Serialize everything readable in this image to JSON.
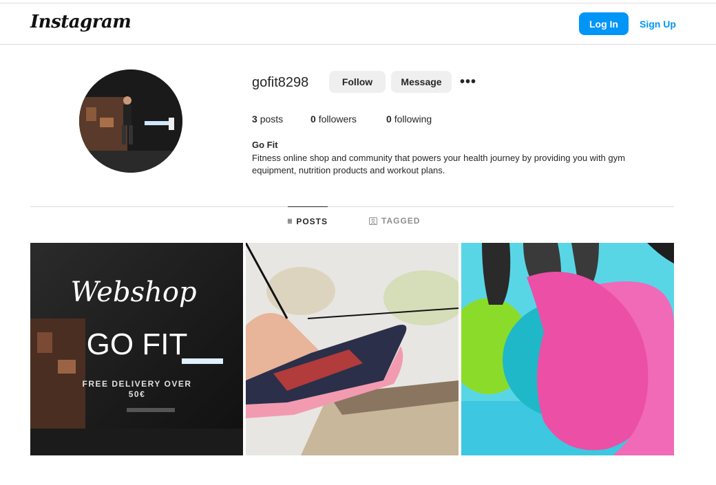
{
  "header": {
    "logo": "Instagram",
    "login_label": "Log In",
    "signup_label": "Sign Up"
  },
  "profile": {
    "username": "gofit8298",
    "follow_label": "Follow",
    "message_label": "Message",
    "more_label": "•••",
    "posts_count": "3",
    "posts_label": "posts",
    "followers_count": "0",
    "followers_label": "followers",
    "following_count": "0",
    "following_label": "following",
    "full_name": "Go Fit",
    "bio": "Fitness online shop and community that powers your health journey by providing you with gym equipment, nutrition products and workout plans."
  },
  "tabs": [
    {
      "label": "POSTS",
      "icon": "grid-icon",
      "active": true
    },
    {
      "label": "TAGGED",
      "icon": "tagged-icon",
      "active": false
    }
  ],
  "posts": [
    {
      "script_text": "Webshop",
      "title": "GO FIT",
      "subtitle_line1": "FREE DELIVERY OVER",
      "subtitle_line2": "50€"
    },
    {
      "description": ""
    },
    {
      "description": ""
    }
  ],
  "colors": {
    "accent": "#0095f6",
    "border": "#dbdbdb",
    "button_gray": "#efefef",
    "text": "#262626",
    "muted": "#8e8e8e"
  }
}
